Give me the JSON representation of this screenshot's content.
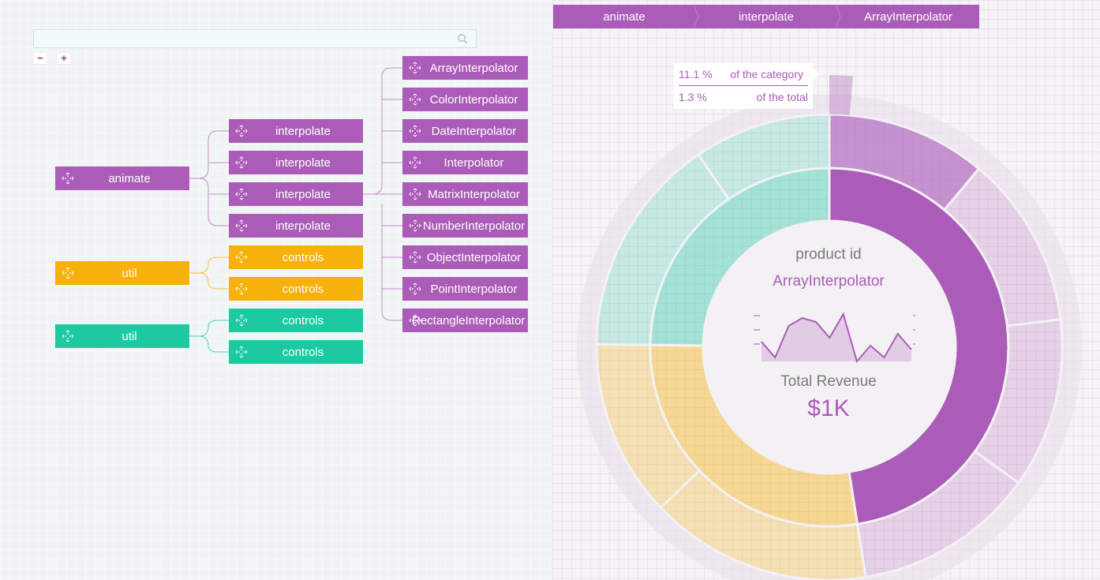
{
  "search": {
    "placeholder": ""
  },
  "zoom": {
    "minus": "−",
    "plus": "+"
  },
  "tree": {
    "roots": [
      {
        "label": "animate",
        "color": "#ab5cb8"
      },
      {
        "label": "util",
        "color": "#f6b10a"
      },
      {
        "label": "util",
        "color": "#1cc9a0"
      }
    ],
    "level2": [
      {
        "label": "interpolate"
      },
      {
        "label": "interpolate"
      },
      {
        "label": "interpolate"
      },
      {
        "label": "interpolate"
      },
      {
        "label": "controls"
      },
      {
        "label": "controls"
      },
      {
        "label": "controls"
      },
      {
        "label": "controls"
      }
    ],
    "level3": [
      {
        "label": "ArrayInterpolator"
      },
      {
        "label": "ColorInterpolator"
      },
      {
        "label": "DateInterpolator"
      },
      {
        "label": "Interpolator"
      },
      {
        "label": "MatrixInterpolator"
      },
      {
        "label": "NumberInterpolator"
      },
      {
        "label": "ObjectInterpolator"
      },
      {
        "label": "PointInterpolator"
      },
      {
        "label": "RectangleInterpolator"
      }
    ],
    "icon": "move-arrows-icon"
  },
  "breadcrumb": [
    "animate",
    "interpolate",
    "ArrayInterpolator"
  ],
  "tooltip": {
    "category_pct": "11.1 %",
    "category_text": "of the category",
    "total_pct": "1.3 %",
    "total_text": "of the total"
  },
  "center": {
    "field_label": "product id",
    "field_value": "ArrayInterpolator",
    "metric_label": "Total Revenue",
    "metric_value": "$1K"
  },
  "colors": {
    "purple": "#ab5cb8",
    "orange": "#f6b10a",
    "teal": "#1cc9a0"
  },
  "chart_data": {
    "type": "sunburst",
    "rings": [
      {
        "level": 1,
        "segments": [
          {
            "name": "animate",
            "value": 47.5,
            "color": "#ab5cb8"
          },
          {
            "name": "util",
            "value": 27.7,
            "color": "#f6b10a"
          },
          {
            "name": "util",
            "value": 24.8,
            "color": "#1cc9a0"
          }
        ]
      },
      {
        "level": 2,
        "segments": [
          {
            "name": "interpolate",
            "value": 11.1,
            "color": "#ab5cb8"
          },
          {
            "name": "interpolate",
            "value": 12.0,
            "color": "#ab5cb8"
          },
          {
            "name": "interpolate",
            "value": 11.8,
            "color": "#ab5cb8"
          },
          {
            "name": "interpolate",
            "value": 12.6,
            "color": "#ab5cb8"
          },
          {
            "name": "controls",
            "value": 15.4,
            "color": "#f6b10a"
          },
          {
            "name": "controls",
            "value": 12.3,
            "color": "#f6b10a"
          },
          {
            "name": "controls",
            "value": 15.3,
            "color": "#1cc9a0"
          },
          {
            "name": "controls",
            "value": 9.5,
            "color": "#1cc9a0"
          }
        ]
      }
    ],
    "sparkline": [
      8,
      4,
      12,
      14,
      13,
      9,
      15,
      3,
      7,
      4,
      10,
      6
    ]
  }
}
